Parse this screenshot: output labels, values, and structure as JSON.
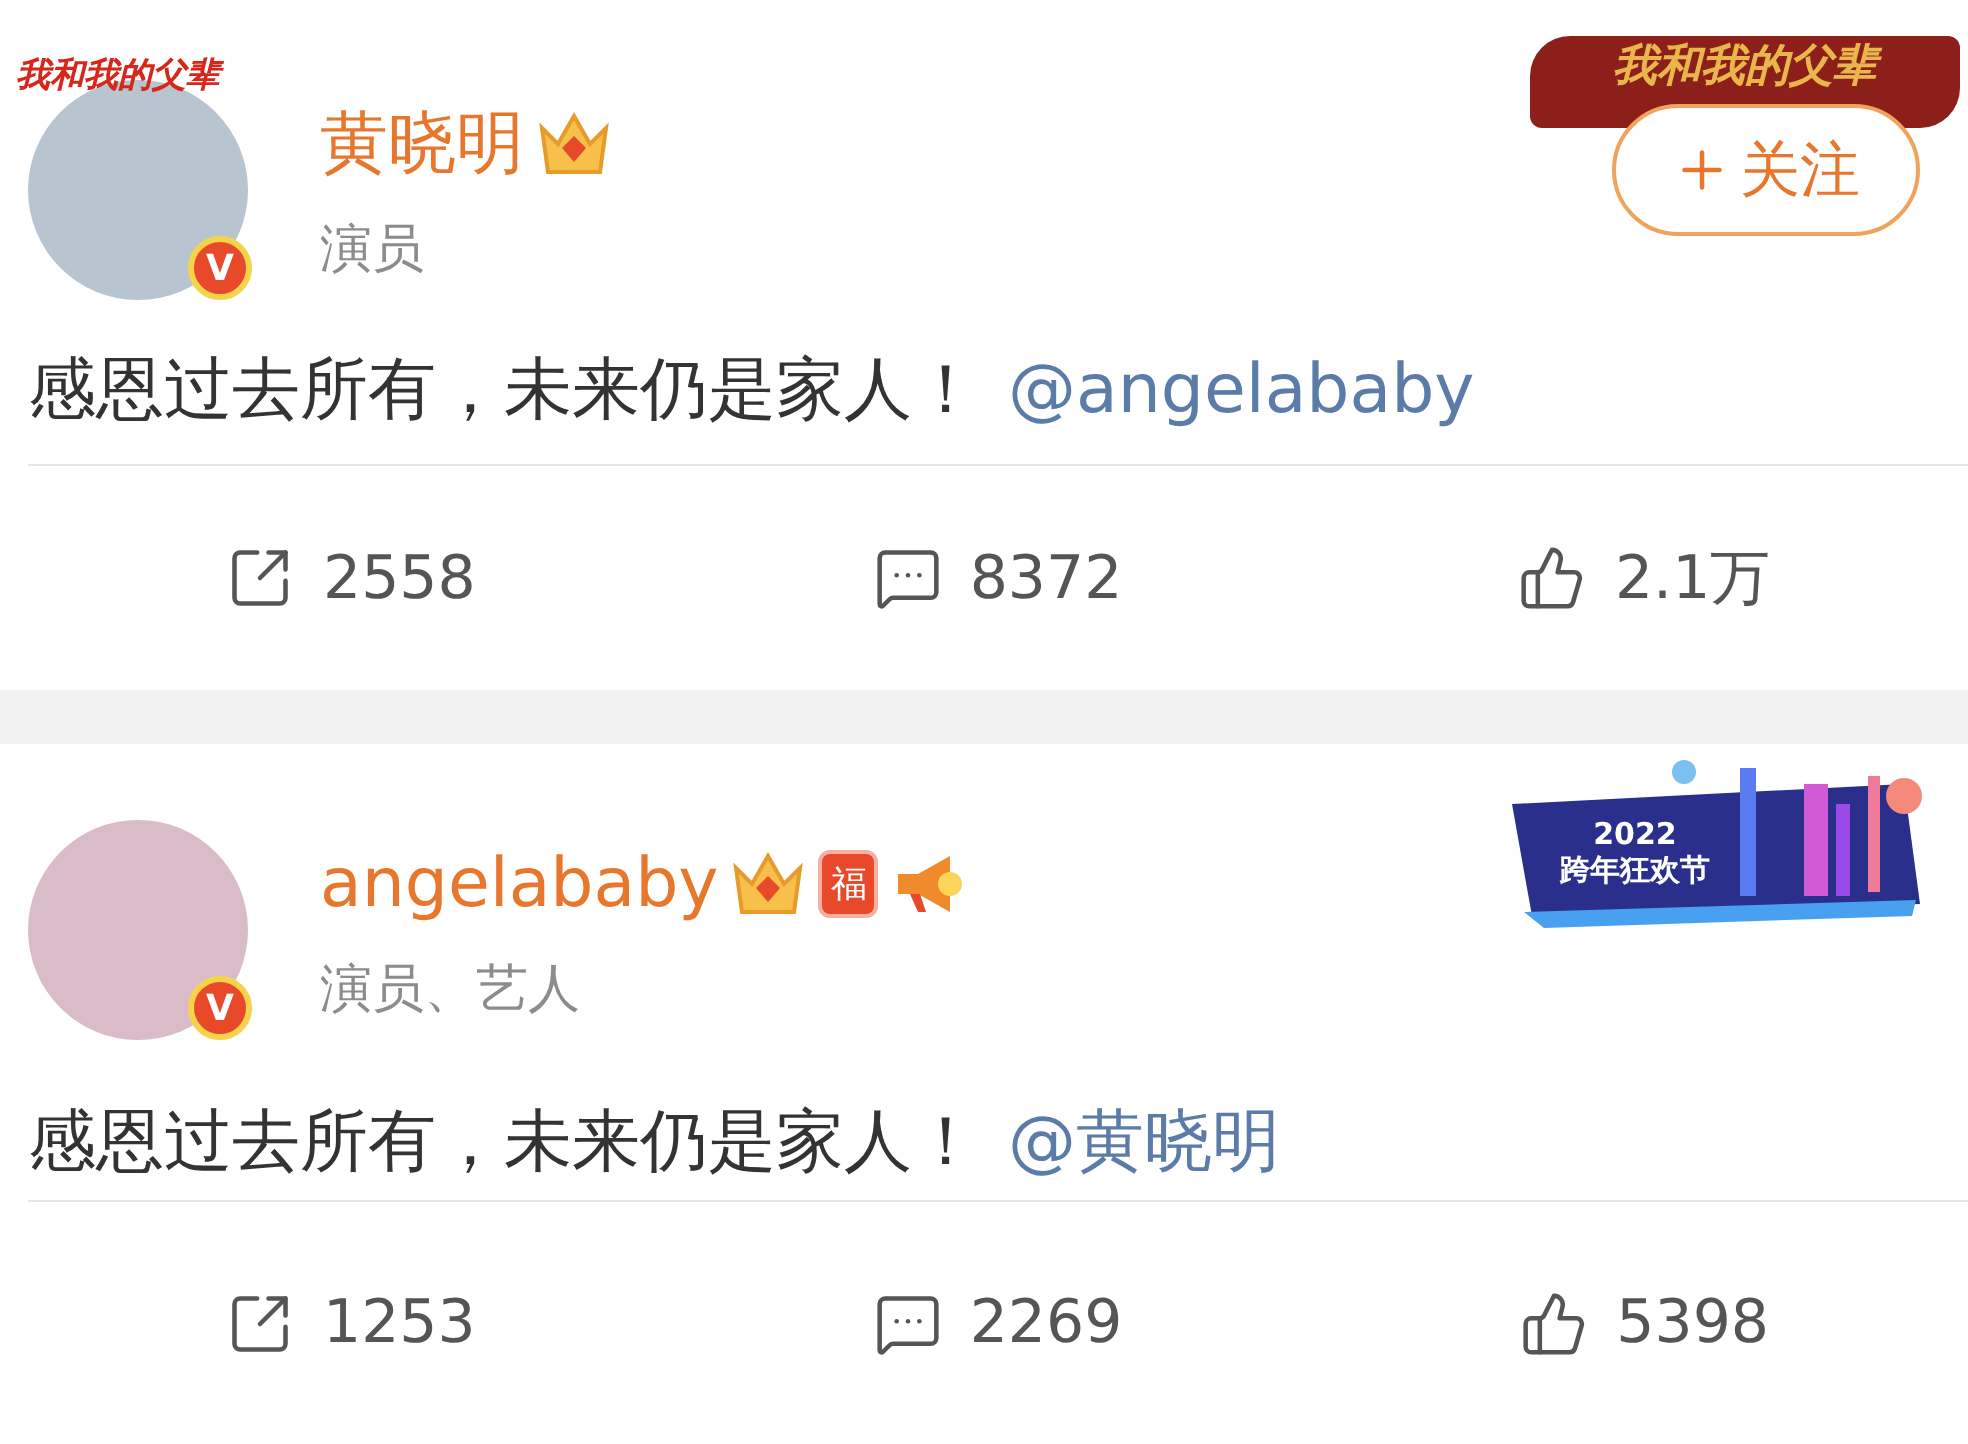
{
  "posts": [
    {
      "avatar_frame_text": "我和我的父辈",
      "name": "黄晓明",
      "badges": [
        {
          "kind": "crown"
        }
      ],
      "verified": "V",
      "subtitle": "演员",
      "banner": {
        "kind": "brush",
        "text": "我和我的父辈"
      },
      "follow_button": {
        "label": "关注"
      },
      "text": "感恩过去所有，未来仍是家人！",
      "mention": "@angelababy",
      "actions": [
        {
          "kind": "repost",
          "count": "2558"
        },
        {
          "kind": "comment",
          "count": "8372"
        },
        {
          "kind": "like",
          "count": "2.1万"
        }
      ]
    },
    {
      "name": "angelababy",
      "badges": [
        {
          "kind": "crown"
        },
        {
          "kind": "fu",
          "text": "福"
        },
        {
          "kind": "megaphone"
        }
      ],
      "verified": "V",
      "subtitle": "演员、艺人",
      "banner": {
        "kind": "city",
        "year": "2022",
        "text": "跨年狂欢节"
      },
      "text": "感恩过去所有，未来仍是家人！",
      "mention": "@黄晓明",
      "actions": [
        {
          "kind": "repost",
          "count": "1253"
        },
        {
          "kind": "comment",
          "count": "2269"
        },
        {
          "kind": "like",
          "count": "5398"
        }
      ]
    }
  ]
}
